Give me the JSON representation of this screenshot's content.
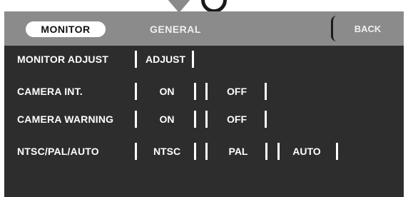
{
  "tabs": {
    "monitor": "MONITOR",
    "general": "GENERAL"
  },
  "back_label": "BACK",
  "rows": [
    {
      "label": "MONITOR ADJUST",
      "options": [
        "ADJUST"
      ]
    },
    {
      "label": "CAMERA INT.",
      "options": [
        "ON",
        "OFF"
      ]
    },
    {
      "label": "CAMERA WARNING",
      "options": [
        "ON",
        "OFF"
      ]
    },
    {
      "label": "NTSC/PAL/AUTO",
      "options": [
        "NTSC",
        "PAL",
        "AUTO"
      ]
    }
  ],
  "icons": [
    "down-arrow-icon",
    "circle-icon"
  ],
  "colors": {
    "background": "#2d2d2d",
    "tab_bar": "#8b8b8b",
    "active_tab": "#ffffff",
    "text": "#ffffff"
  }
}
